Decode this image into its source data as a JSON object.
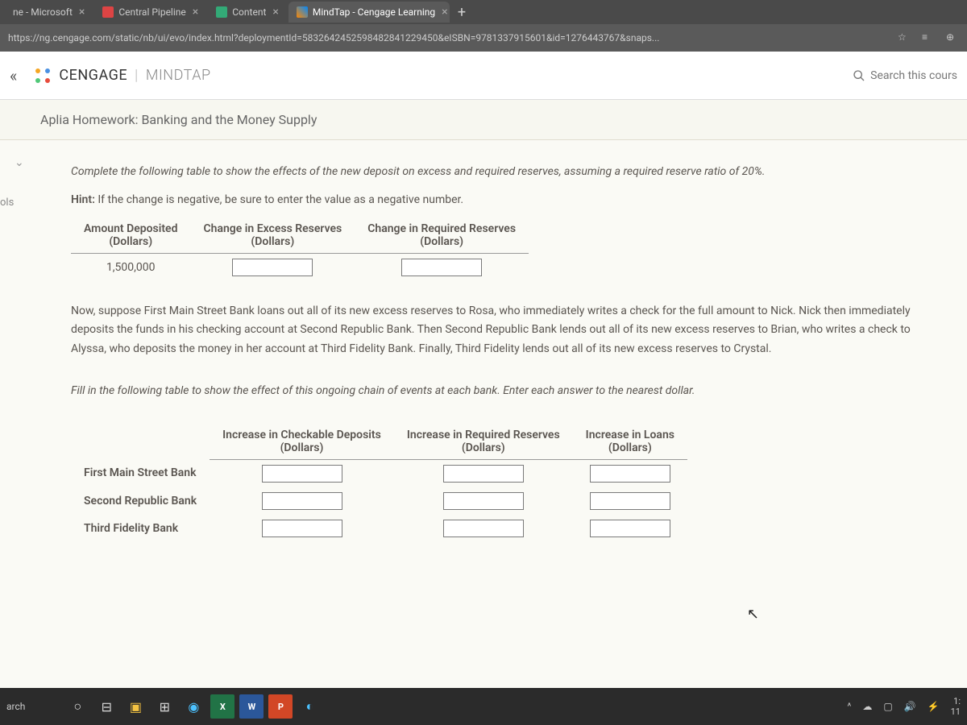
{
  "browser": {
    "tabs": [
      {
        "label": "ne - Microsoft",
        "active": false
      },
      {
        "label": "Central Pipeline",
        "active": false
      },
      {
        "label": "Content",
        "active": false
      },
      {
        "label": "MindTap - Cengage Learning",
        "active": true
      }
    ],
    "url": "https://ng.cengage.com/static/nb/ui/evo/index.html?deploymentId=5832642452598482841229450&eISBN=9781337915601&id=1276443767&snaps..."
  },
  "header": {
    "brand_primary": "CENGAGE",
    "brand_secondary": "MINDTAP",
    "search_placeholder": "Search this cours"
  },
  "assignment": {
    "title": "Aplia Homework: Banking and the Money Supply"
  },
  "sidebar": {
    "tools_label": "ols"
  },
  "content": {
    "instruction1": "Complete the following table to show the effects of the new deposit on excess and required reserves, assuming a required reserve ratio of 20%.",
    "hint_label": "Hint:",
    "hint_text": " If the change is negative, be sure to enter the value as a negative number.",
    "table1": {
      "col1_h": "Amount Deposited",
      "col2_h": "Change in Excess Reserves",
      "col3_h": "Change in Required Reserves",
      "unit": "(Dollars)",
      "row1_amount": "1,500,000"
    },
    "paragraph1": "Now, suppose First Main Street Bank loans out all of its new excess reserves to Rosa, who immediately writes a check for the full amount to Nick. Nick then immediately deposits the funds in his checking account at Second Republic Bank. Then Second Republic Bank lends out all of its new excess reserves to Brian, who writes a check to Alyssa, who deposits the money in her account at Third Fidelity Bank. Finally, Third Fidelity lends out all of its new excess reserves to Crystal.",
    "instruction2": "Fill in the following table to show the effect of this ongoing chain of events at each bank. Enter each answer to the nearest dollar.",
    "table2": {
      "col1_h": "Increase in Checkable Deposits",
      "col2_h": "Increase in Required Reserves",
      "col3_h": "Increase in Loans",
      "unit": "(Dollars)",
      "rows": [
        "First Main Street Bank",
        "Second Republic Bank",
        "Third Fidelity Bank"
      ]
    }
  },
  "taskbar": {
    "search_label": "arch",
    "time": "1:",
    "date": "11"
  }
}
